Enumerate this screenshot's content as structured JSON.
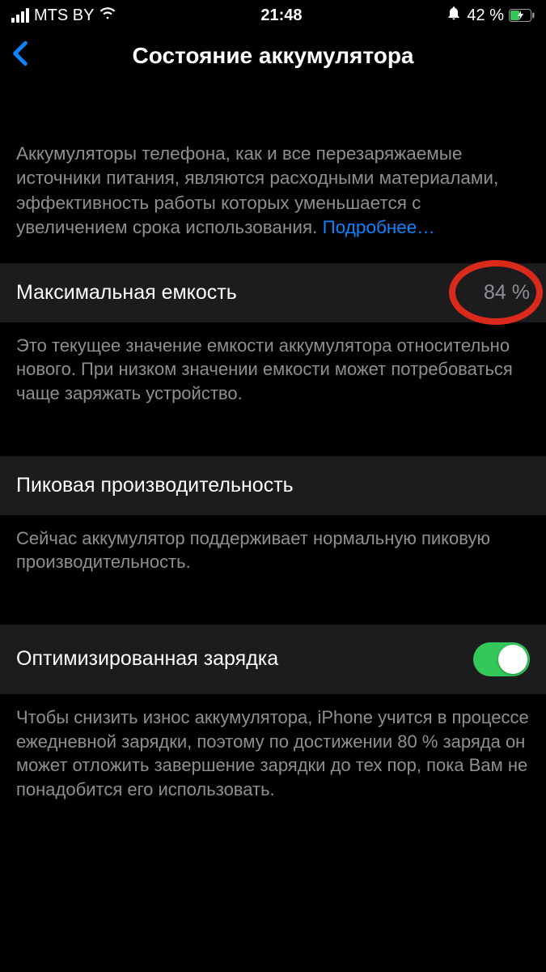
{
  "statusbar": {
    "carrier": "MTS BY",
    "time": "21:48",
    "battery_text": "42 %"
  },
  "nav": {
    "title": "Состояние аккумулятора"
  },
  "intro": {
    "text": "Аккумуляторы телефона, как и все перезаряжаемые источники питания, являются расходными материалами, эффективность работы которых уменьшается с увеличением срока использования. ",
    "learn_more": "Подробнее…"
  },
  "capacity": {
    "label": "Максимальная емкость",
    "value": "84 %",
    "footer": "Это текущее значение емкости аккумулятора относительно нового. При низком значении емкости может потребоваться чаще заряжать устройство."
  },
  "peak": {
    "label": "Пиковая производительность",
    "footer": "Сейчас аккумулятор поддерживает нормальную пиковую производительность."
  },
  "optimized": {
    "label": "Оптимизированная зарядка",
    "footer": "Чтобы снизить износ аккумулятора, iPhone учится в процессе ежедневной зарядки, поэтому по достижении 80 % заряда он может отложить завершение зарядки до тех пор, пока Вам не понадобится его использовать."
  }
}
